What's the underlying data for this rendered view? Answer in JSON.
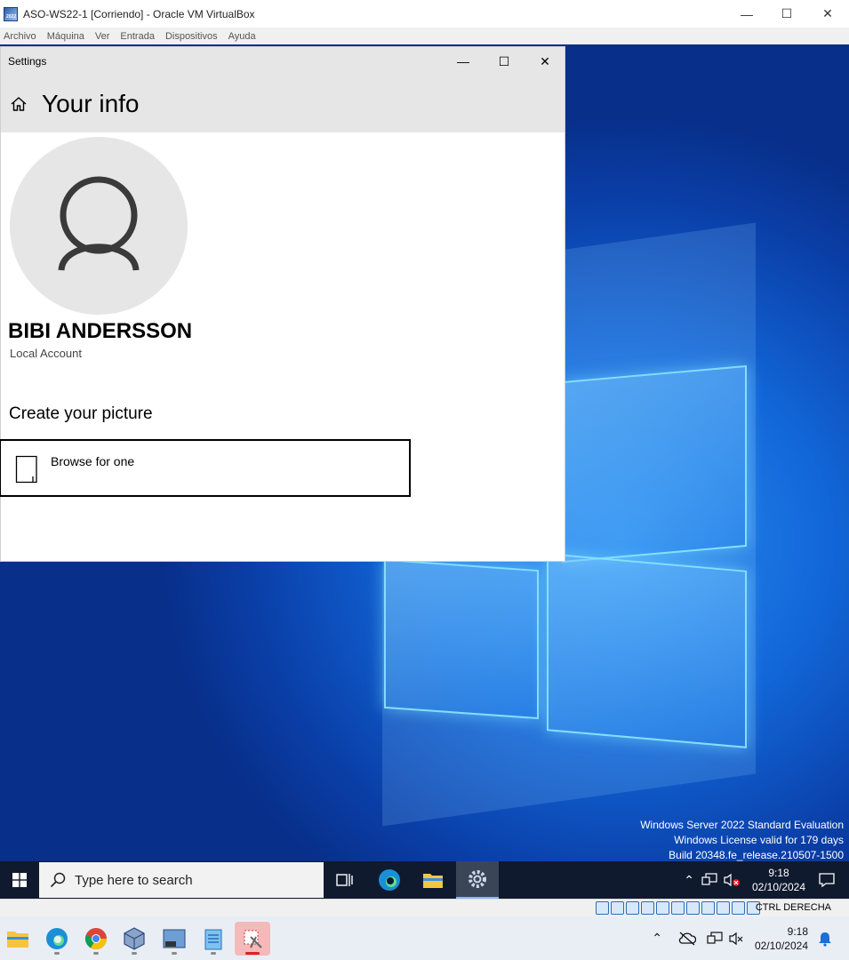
{
  "vbox": {
    "title": "ASO-WS22-1 [Corriendo] - Oracle VM VirtualBox",
    "menu": [
      "Archivo",
      "Máquina",
      "Ver",
      "Entrada",
      "Dispositivos",
      "Ayuda"
    ],
    "host_key": "CTRL DERECHA"
  },
  "settings": {
    "window_title": "Settings",
    "page_title": "Your info",
    "user_name": "BIBI ANDERSSON",
    "account_type": "Local Account",
    "create_picture_heading": "Create your picture",
    "browse_label": "Browse for one"
  },
  "watermark": {
    "line1": "Windows Server 2022 Standard Evaluation",
    "line2": "Windows License valid for 179 days",
    "line3": "Build 20348.fe_release.210507-1500"
  },
  "guest_taskbar": {
    "search_placeholder": "Type here to search",
    "time": "9:18",
    "date": "02/10/2024"
  },
  "host_taskbar": {
    "time": "9:18",
    "date": "02/10/2024",
    "apps": [
      "file-explorer",
      "edge",
      "chrome",
      "virtualbox",
      "server-manager",
      "notepad",
      "snipping-tool"
    ]
  },
  "colors": {
    "guest_taskbar": "#0f1a2e",
    "desktop_blue": "#1266d8",
    "settings_header": "#e6e6e6"
  }
}
